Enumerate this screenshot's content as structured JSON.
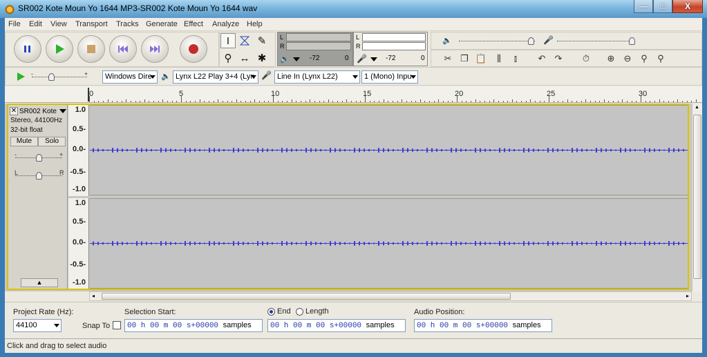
{
  "window": {
    "title": "SR002 Kote Moun Yo 1644 MP3-SR002 Kote Moun Yo 1644 wav",
    "minimize": "—",
    "maximize": "□",
    "close": "X"
  },
  "menu": [
    "File",
    "Edit",
    "View",
    "Transport",
    "Tracks",
    "Generate",
    "Effect",
    "Analyze",
    "Help"
  ],
  "meters": {
    "playback": {
      "channels": [
        "L",
        "R"
      ],
      "db_low": "-72",
      "db_high": "0"
    },
    "record": {
      "channels": [
        "L",
        "R"
      ],
      "db_low": "-72",
      "db_high": "0"
    }
  },
  "device_bar": {
    "host": "Windows Dire",
    "output": "Lynx L22 Play 3+4 (Lyn",
    "input": "Line In (Lynx L22)",
    "channels": "1 (Mono) Inpu"
  },
  "ruler": {
    "labels": [
      "0",
      "5",
      "10",
      "15",
      "20",
      "25",
      "30"
    ]
  },
  "track": {
    "name": "SR002 Kote",
    "format": "Stereo, 44100Hz",
    "bitdepth": "32-bit float",
    "mute": "Mute",
    "solo": "Solo",
    "gain_minus": "-",
    "gain_plus": "+",
    "pan_left": "L",
    "pan_right": "R",
    "scale": [
      "1.0",
      "0.5-",
      "0.0-",
      "-0.5-",
      "-1.0"
    ]
  },
  "selection": {
    "project_rate_label": "Project Rate (Hz):",
    "project_rate": "44100",
    "snap_to": "Snap To",
    "selection_start_label": "Selection Start:",
    "end_label": "End",
    "length_label": "Length",
    "audio_position_label": "Audio Position:",
    "time_digits": "00 h 00 m 00 s+00000",
    "units": "samples"
  },
  "status": "Click and drag to select audio"
}
